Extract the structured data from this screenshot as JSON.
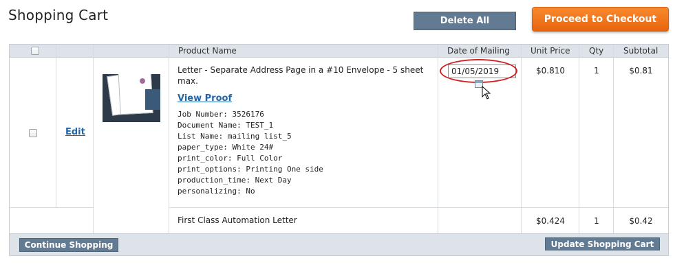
{
  "page": {
    "title": "Shopping Cart"
  },
  "actions": {
    "delete_all": "Delete All",
    "checkout": "Proceed to Checkout"
  },
  "table": {
    "headers": {
      "product_name": "Product Name",
      "date_of_mailing": "Date of Mailing",
      "unit_price": "Unit Price",
      "qty": "Qty",
      "subtotal": "Subtotal"
    }
  },
  "items": [
    {
      "edit_label": "Edit",
      "title": "Letter - Separate Address Page in a #10 Envelope - 5 sheet max.",
      "view_proof_label": "View Proof",
      "details": [
        "Job Number: 3526176",
        "Document Name: TEST_1",
        "List Name: mailing list_5",
        "paper_type: White 24#",
        "print_color: Full Color",
        "print_options: Printing One side",
        "production_time: Next Day",
        "personalizing: No"
      ],
      "mailing_date": "01/05/2019",
      "unit_price": "$0.810",
      "qty": "1",
      "subtotal": "$0.81"
    },
    {
      "title": "First Class Automation Letter",
      "unit_price": "$0.424",
      "qty": "1",
      "subtotal": "$0.42"
    }
  ],
  "footer": {
    "continue": "Continue Shopping",
    "update": "Update Shopping Cart"
  },
  "colors": {
    "accent": "#f07a20",
    "button_gray": "#627b92",
    "link": "#2266aa",
    "highlight": "#d21f1f"
  }
}
